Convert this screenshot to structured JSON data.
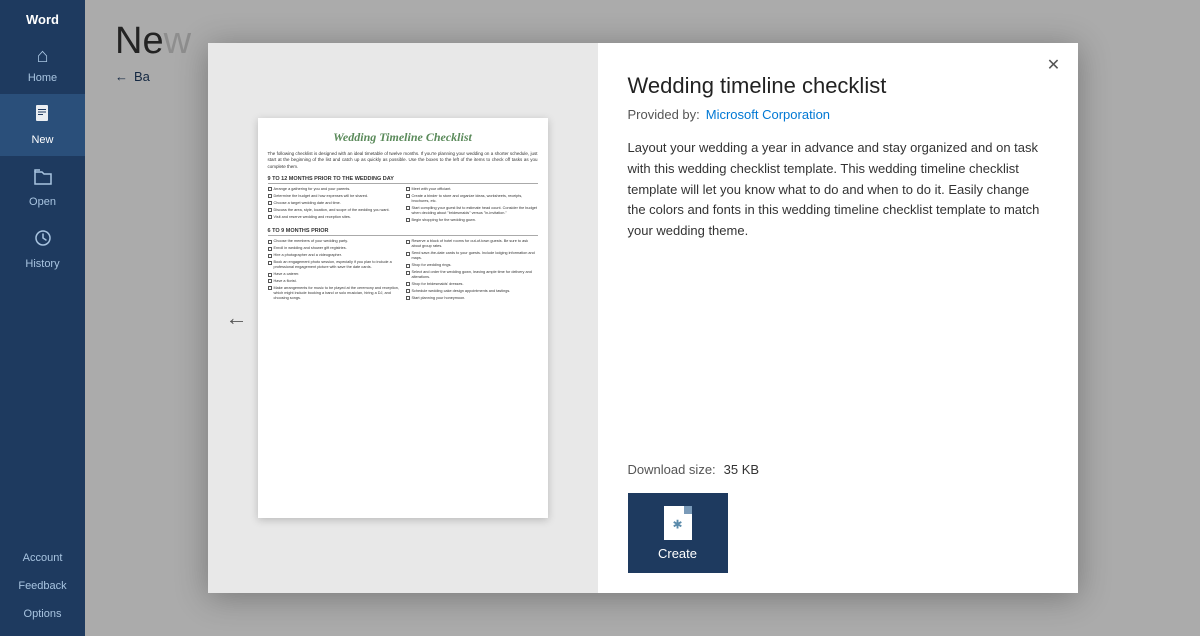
{
  "app": {
    "name": "Word"
  },
  "sidebar": {
    "items": [
      {
        "id": "home",
        "label": "Home",
        "icon": "⌂"
      },
      {
        "id": "new",
        "label": "New",
        "icon": "📄",
        "active": true
      },
      {
        "id": "open",
        "label": "Open",
        "icon": "📂"
      },
      {
        "id": "history",
        "label": "History",
        "icon": "🕐"
      }
    ],
    "bottom_items": [
      {
        "id": "account",
        "label": "Account"
      },
      {
        "id": "feedback",
        "label": "Feedback"
      },
      {
        "id": "options",
        "label": "Options"
      }
    ]
  },
  "main": {
    "title": "Ne",
    "back_text": "Ba",
    "back_icon": "←"
  },
  "modal": {
    "close_icon": "✕",
    "template": {
      "title": "Wedding timeline checklist",
      "provider_label": "Provided by:",
      "provider_name": "Microsoft Corporation",
      "description": "Layout your wedding a year in advance and stay organized and on task with this wedding checklist template. This wedding timeline checklist template will let you know what to do and when to do it. Easily change the colors and fonts in this wedding timeline checklist template to match your wedding theme.",
      "download_label": "Download size:",
      "download_size": "35 KB",
      "create_label": "Create"
    },
    "prev_arrow": "←",
    "doc_preview": {
      "title": "Wedding Timeline Checklist",
      "intro": "The following checklist is designed with an ideal timetable of twelve months. If you're planning your wedding on a shorter schedule, just start at the beginning of the list and catch up as quickly as possible. Use the boxes to the left of the items to check off tasks as you complete them.",
      "section1": {
        "header": "9 TO 12 MONTHS PRIOR TO THE WEDDING DAY",
        "col1_items": [
          "Arrange a gathering for you and your parents.",
          "Determine the budget and how expenses will be shared.",
          "Choose a target wedding date and time.",
          "Discuss the area, style, location, and scope of the wedding you want.",
          "Visit and reserve wedding and reception sites."
        ],
        "col2_items": [
          "Meet with your officiant.",
          "Create a binder to store and organize ideas, worksheets, receipts, brochures, etc.",
          "Start compiling your guest list to estimate head count. Consider the budget when deciding about \"bridesmaids\" versus \"in-invitation.\"",
          "Begin shopping for the wedding gown."
        ]
      },
      "section2": {
        "header": "6 TO 9 MONTHS PRIOR",
        "col1_items": [
          "Choose the members of your wedding party.",
          "Enroll in wedding and shower gift registries.",
          "Hire a photographer and a videographer.",
          "Book an engagement photo session, especially if you plan to include a professional engagement picture with save the date cards.",
          "Have a caterer.",
          "Have a florist.",
          "Make arrangements for music to be played at the ceremony and reception, which might include booking a band or solo musician, hiring a DJ, and choosing songs."
        ],
        "col2_items": [
          "Reserve a block of hotel rooms for out-of-town guests. Be sure to ask about group rates.",
          "Send save-the-date cards to your guests. Include lodging information and maps.",
          "Shop for wedding rings.",
          "Select and order the wedding gown, leaving ample time for delivery and alterations.",
          "Shop for bridesmaids' dresses.",
          "Schedule wedding cake design appointments and tastings.",
          "Start planning your honeymoon."
        ]
      }
    }
  }
}
